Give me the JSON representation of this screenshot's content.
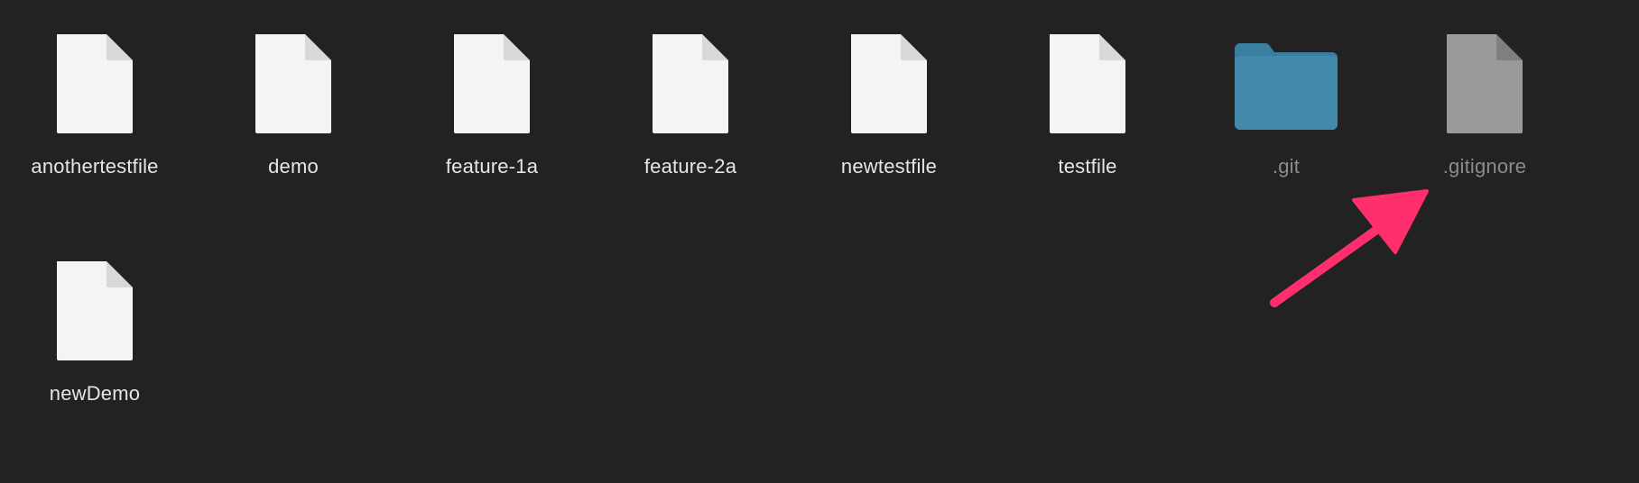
{
  "files": [
    {
      "name": "anothertestfile",
      "kind": "document",
      "hidden": false
    },
    {
      "name": "demo",
      "kind": "document",
      "hidden": false
    },
    {
      "name": "feature-1a",
      "kind": "document",
      "hidden": false
    },
    {
      "name": "feature-2a",
      "kind": "document",
      "hidden": false
    },
    {
      "name": "newtestfile",
      "kind": "document",
      "hidden": false
    },
    {
      "name": "testfile",
      "kind": "document",
      "hidden": false
    },
    {
      "name": ".git",
      "kind": "folder",
      "hidden": true
    },
    {
      "name": ".gitignore",
      "kind": "document",
      "hidden": true
    },
    {
      "name": "newDemo",
      "kind": "document",
      "hidden": false
    }
  ],
  "icons": {
    "document": "document-icon",
    "folder": "folder-icon",
    "annotation": "arrow-annotation"
  },
  "colors": {
    "background": "#232222",
    "document": "#f4f4f4",
    "hidden_document": "#9a9a9a",
    "folder": "#3f86a7",
    "arrow": "#ff2f6e"
  }
}
